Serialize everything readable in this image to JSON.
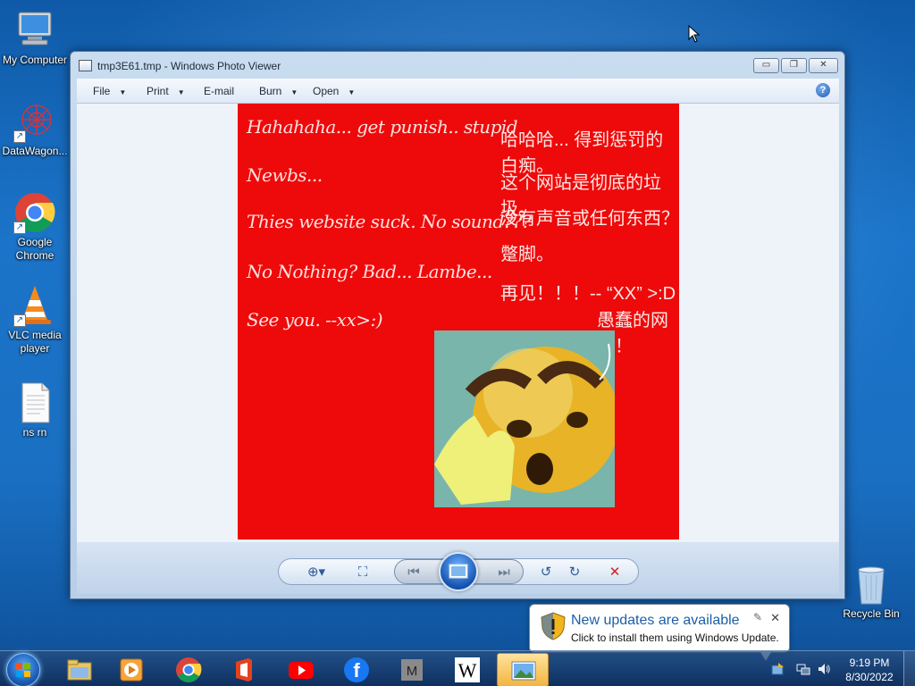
{
  "desktop": {
    "icons": [
      {
        "label": "My Computer",
        "icon": "computer-icon"
      },
      {
        "label": "DataWagon...",
        "icon": "datawagon-icon"
      },
      {
        "label": "Google Chrome",
        "icon": "chrome-icon"
      },
      {
        "label": "VLC media player",
        "icon": "vlc-icon"
      },
      {
        "label": "ns rn",
        "icon": "document-icon"
      },
      {
        "label": "Recycle Bin",
        "icon": "recycle-bin-icon"
      }
    ]
  },
  "window": {
    "title": "tmp3E61.tmp - Windows Photo Viewer",
    "menu": [
      {
        "label": "File",
        "has_dropdown": true
      },
      {
        "label": "Print",
        "has_dropdown": true
      },
      {
        "label": "E-mail",
        "has_dropdown": false
      },
      {
        "label": "Burn",
        "has_dropdown": true
      },
      {
        "label": "Open",
        "has_dropdown": true
      }
    ],
    "help_label": "?",
    "image": {
      "background": "#ee0a0a",
      "english_lines": [
        "Hahahaha... get  punish.. stupid",
        "Newbs...",
        "Thies website suck. No sound???",
        "No Nothing? Bad... Lambe...",
        "See you. --xx>:)"
      ],
      "chinese_lines": [
        "哈哈哈... 得到惩罚的白痴。",
        "这个网站是彻底的垃圾。",
        "没有声音或任何东西？",
        "蹩脚。",
        "再见！！！-- “XX” >:D",
        "愚蠢的网站！"
      ]
    }
  },
  "notification": {
    "title": "New updates are available",
    "body": "Click to install them using Windows Update.",
    "close": "✕",
    "pin": "✎"
  },
  "taskbar": {
    "apps": [
      "file-explorer-icon",
      "media-player-icon",
      "chrome-icon",
      "office-icon",
      "youtube-icon",
      "facebook-icon",
      "m-app-icon",
      "wikipedia-icon",
      "photo-viewer-icon"
    ],
    "m_letter": "M",
    "wiki_letter": "W",
    "fb_letter": "f",
    "time": "9:19 PM",
    "date": "8/30/2022"
  }
}
